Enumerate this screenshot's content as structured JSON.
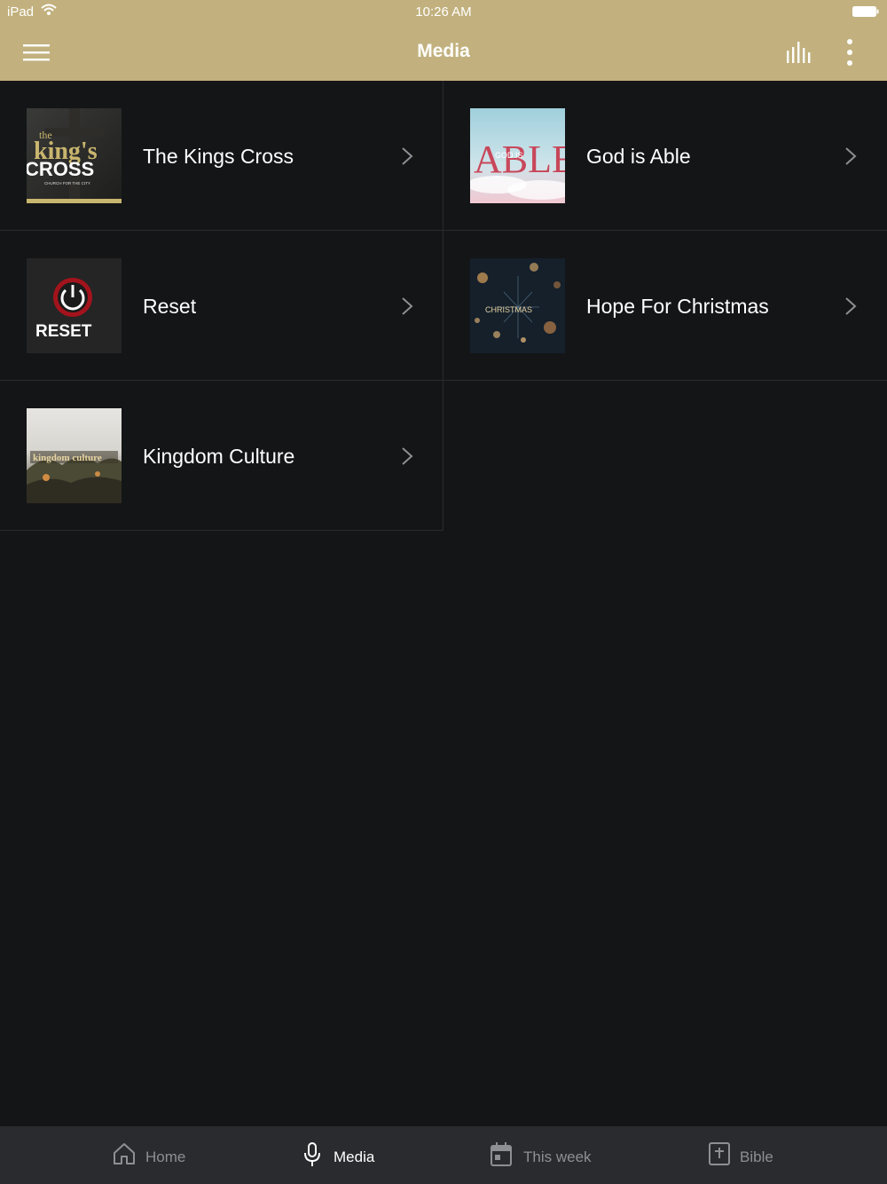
{
  "status_bar": {
    "device": "iPad",
    "time": "10:26 AM"
  },
  "header": {
    "title": "Media",
    "accent_color": "#c2b17e"
  },
  "series": [
    {
      "label": "The Kings Cross",
      "art": {
        "line1": "the",
        "line2": "king's",
        "line3": "CROSS",
        "line4": "CHURCH FOR THE CITY"
      }
    },
    {
      "label": "God is Able",
      "art": {
        "line1": "ABLE",
        "line2": "GOD IS"
      }
    },
    {
      "label": "Reset",
      "art": {
        "line1": "RESET"
      }
    },
    {
      "label": "Hope For Christmas",
      "art": {
        "line1": "CHRISTMAS"
      }
    },
    {
      "label": "Kingdom Culture",
      "art": {
        "line1": "kingdom culture"
      }
    }
  ],
  "tabs": [
    {
      "label": "Home",
      "icon": "home-icon",
      "active": false
    },
    {
      "label": "Media",
      "icon": "microphone-icon",
      "active": true
    },
    {
      "label": "This week",
      "icon": "calendar-icon",
      "active": false
    },
    {
      "label": "Bible",
      "icon": "bible-icon",
      "active": false
    }
  ],
  "colors": {
    "background": "#141517",
    "tab_bar": "#2a2b2e",
    "tab_inactive": "#8e8f93",
    "tab_active": "#ffffff"
  }
}
